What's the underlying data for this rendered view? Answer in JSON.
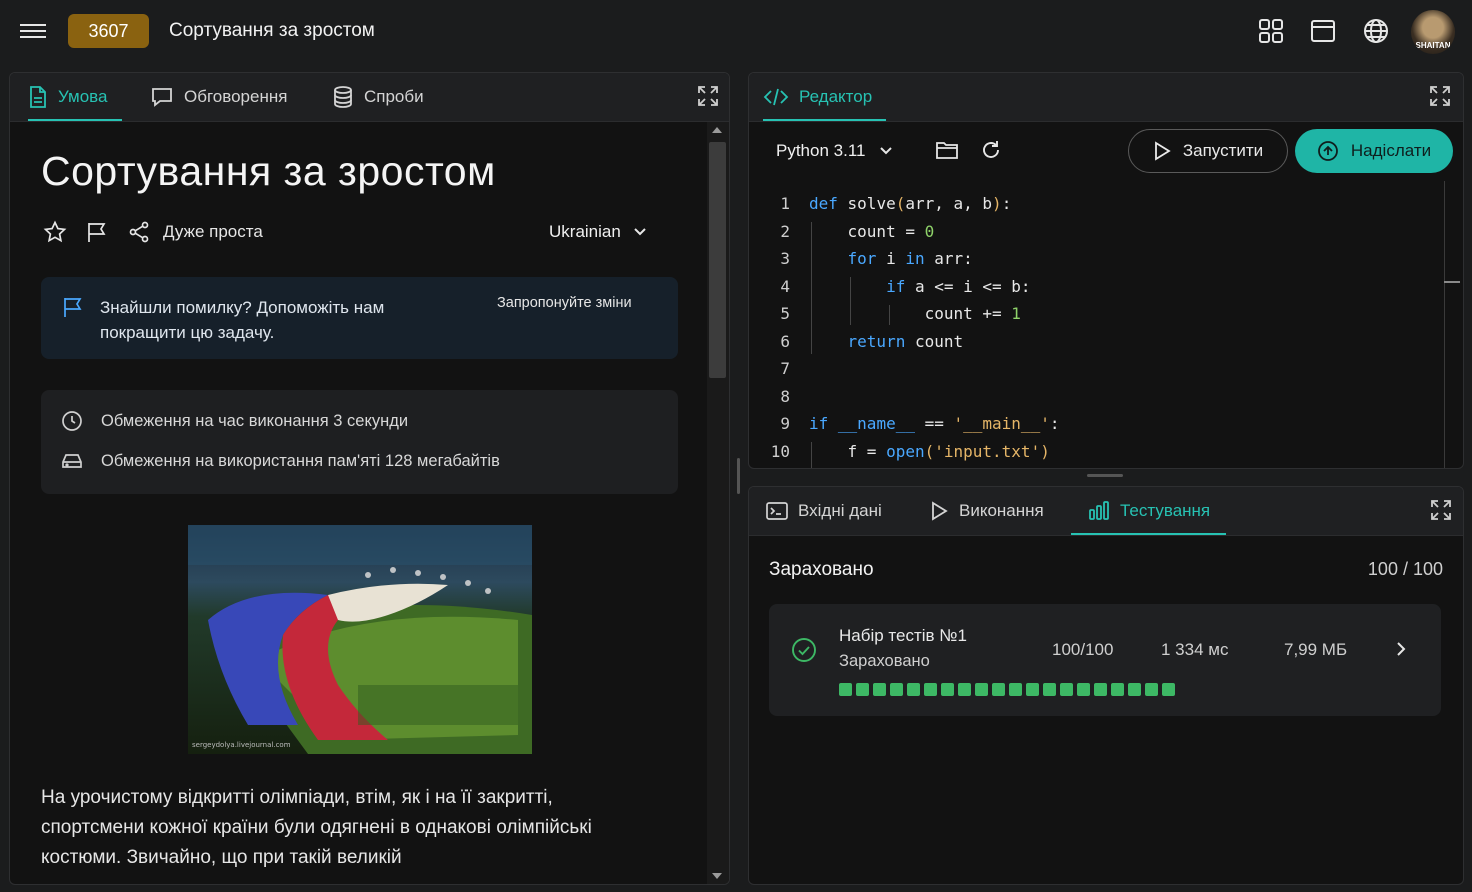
{
  "topbar": {
    "problem_number": "3607",
    "problem_title": "Сортування за зростом"
  },
  "left_panel": {
    "tabs": [
      {
        "label": "Умова",
        "active": true
      },
      {
        "label": "Обговорення",
        "active": false
      },
      {
        "label": "Спроби",
        "active": false
      }
    ],
    "title": "Сортування за зростом",
    "difficulty": "Дуже проста",
    "language": "Ukrainian",
    "notice": {
      "text": "Знайшли помилку? Допоможіть нам покращити цю задачу.",
      "suggest": "Запропонуйте зміни"
    },
    "limits": [
      "Обмеження на час виконання 3 секунди",
      "Обмеження на використання пам'яті 128 мегабайтів"
    ],
    "image_caption": "sergeydolya.livejournal.com",
    "paragraph": "На урочистому відкритті олімпіади, втім, як і на її закритті, спортсмени кожної країни були одягнені в однакові олімпійські костюми. Звичайно, що при такій великій"
  },
  "editor": {
    "tab": "Редактор",
    "language": "Python 3.11",
    "run_label": "Запустити",
    "submit_label": "Надіслати",
    "line_numbers": [
      "1",
      "2",
      "3",
      "4",
      "5",
      "6",
      "7",
      "8",
      "9",
      "10"
    ]
  },
  "bottom": {
    "tabs": [
      {
        "label": "Вхідні дані",
        "active": false
      },
      {
        "label": "Виконання",
        "active": false
      },
      {
        "label": "Тестування",
        "active": true
      }
    ],
    "result": "Зараховано",
    "score": "100 / 100",
    "testset": {
      "name": "Набір тестів №1",
      "status": "Зараховано",
      "points": "100/100",
      "time": "1 334 мс",
      "memory": "7,99 МБ",
      "passed_tests": 20
    }
  },
  "colors": {
    "accent": "#27c2b3",
    "badge": "#8a6210",
    "pass": "#3db865"
  }
}
